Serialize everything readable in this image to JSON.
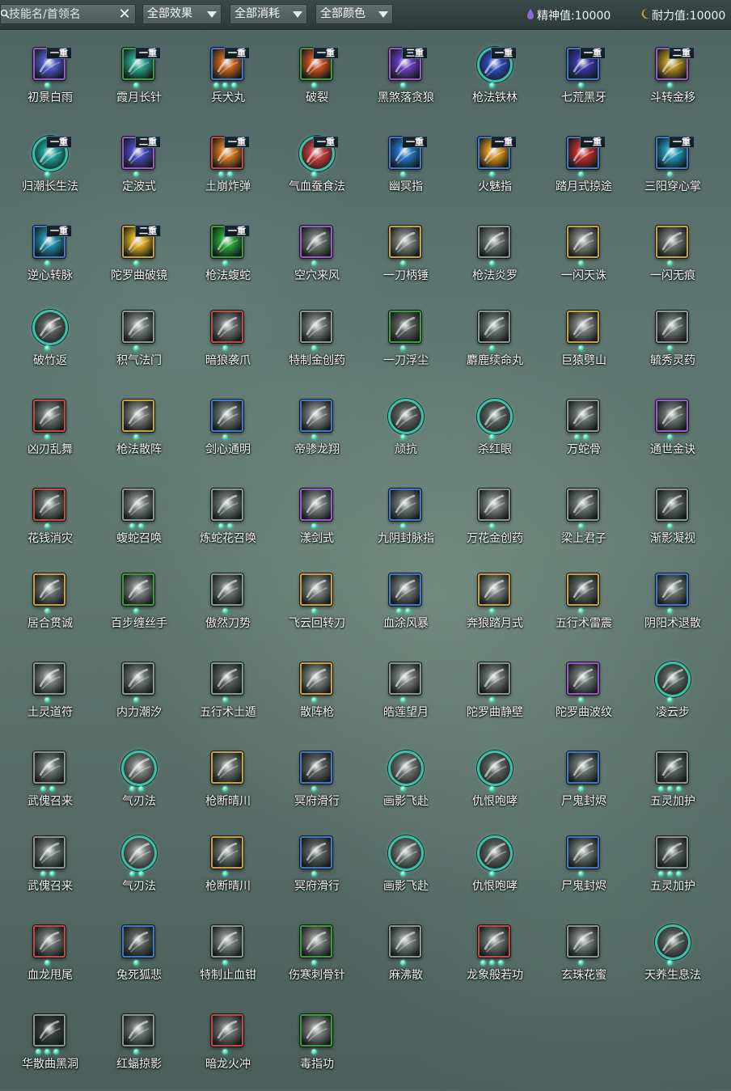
{
  "toolbar": {
    "search_placeholder": "技能名/首领名",
    "clear_label": "✕",
    "filters": [
      {
        "label": "全部效果"
      },
      {
        "label": "全部消耗"
      },
      {
        "label": "全部颜色"
      }
    ],
    "stats": [
      {
        "label": "精神值:10000",
        "icon": "spirit-drop-icon",
        "color": "#8a6cd8"
      },
      {
        "label": "耐力值:10000",
        "icon": "stamina-moon-icon",
        "color": "#d89a3c"
      }
    ]
  },
  "rarity_colors": {
    "gray": "#8a9491",
    "blue": "#3f78c8",
    "purple": "#9a58c8",
    "gold": "#c9a03a",
    "green": "#3f9a3f",
    "red": "#c04848",
    "teal": "#3fbfa8"
  },
  "skills": [
    {
      "name": "初景白雨",
      "tier": "一重",
      "rarity": "purple",
      "shape": "sq",
      "dots": 1,
      "art": "#4d59c9"
    },
    {
      "name": "霞月长针",
      "tier": "一重",
      "rarity": "green",
      "shape": "sq",
      "dots": 1,
      "art": "#2aa58c"
    },
    {
      "name": "兵犬丸",
      "tier": "一重",
      "rarity": "blue",
      "shape": "sq",
      "dots": 3,
      "art": "#c8641e"
    },
    {
      "name": "破裂",
      "tier": "一重",
      "rarity": "green",
      "shape": "sq",
      "dots": 1,
      "art": "#c8501e"
    },
    {
      "name": "黑煞落贪狼",
      "tier": "三重",
      "rarity": "purple",
      "shape": "sq",
      "dots": 1,
      "art": "#6a3cc0"
    },
    {
      "name": "枪法铁林",
      "tier": "一重",
      "rarity": "teal",
      "shape": "circ",
      "dots": 1,
      "art": "#2a48b4"
    },
    {
      "name": "七荒黑牙",
      "tier": "一重",
      "rarity": "blue",
      "shape": "sq",
      "dots": 1,
      "art": "#3838a8"
    },
    {
      "name": "斗转金移",
      "tier": "二重",
      "rarity": "purple",
      "shape": "sq",
      "dots": 1,
      "art": "#b48c1e"
    },
    {
      "name": "归潮长生法",
      "tier": "一重",
      "rarity": "teal",
      "shape": "circ",
      "dots": 1,
      "art": "#1e9c96"
    },
    {
      "name": "定波式",
      "tier": "二重",
      "rarity": "purple",
      "shape": "sq",
      "dots": 1,
      "art": "#4848c0"
    },
    {
      "name": "土崩炸弹",
      "tier": "一重",
      "rarity": "red",
      "shape": "sq",
      "dots": 2,
      "art": "#d8781e"
    },
    {
      "name": "气血蚕食法",
      "tier": "一重",
      "rarity": "teal",
      "shape": "circ",
      "dots": 1,
      "art": "#c03c3c"
    },
    {
      "name": "幽冥指",
      "tier": "一重",
      "rarity": "blue",
      "shape": "sq",
      "dots": 1,
      "art": "#2474c8"
    },
    {
      "name": "火魅指",
      "tier": "一重",
      "rarity": "blue",
      "shape": "sq",
      "dots": 1,
      "art": "#d8901e"
    },
    {
      "name": "踏月式掠途",
      "tier": "一重",
      "rarity": "blue",
      "shape": "sq",
      "dots": 1,
      "art": "#c02c2c"
    },
    {
      "name": "三阳穿心掌",
      "tier": "一重",
      "rarity": "blue",
      "shape": "sq",
      "dots": 1,
      "art": "#1e96b4"
    },
    {
      "name": "逆心转脉",
      "tier": "一重",
      "rarity": "blue",
      "shape": "sq",
      "dots": 1,
      "art": "#1e8ca8"
    },
    {
      "name": "陀罗曲破镜",
      "tier": "二重",
      "rarity": "gold",
      "shape": "sq",
      "dots": 1,
      "art": "#d8a81e"
    },
    {
      "name": "枪法蝮蛇",
      "tier": "一重",
      "rarity": "green",
      "shape": "sq",
      "dots": 1,
      "art": "#2aa03c"
    },
    {
      "name": "空穴来风",
      "tier": "",
      "rarity": "purple",
      "shape": "sq",
      "dots": 1,
      "art": "#6c7470"
    },
    {
      "name": "一刀柄锤",
      "tier": "",
      "rarity": "gold",
      "shape": "sq",
      "dots": 1,
      "art": "#7a807c"
    },
    {
      "name": "枪法炎罗",
      "tier": "",
      "rarity": "gray",
      "shape": "sq",
      "dots": 1,
      "art": "#6c7470"
    },
    {
      "name": "一闪天诛",
      "tier": "",
      "rarity": "gold",
      "shape": "sq",
      "dots": 1,
      "art": "#7a807c"
    },
    {
      "name": "一闪无痕",
      "tier": "",
      "rarity": "gold",
      "shape": "sq",
      "dots": 1,
      "art": "#6c7470"
    },
    {
      "name": "破竹返",
      "tier": "",
      "rarity": "teal",
      "shape": "circ",
      "dots": 1,
      "art": "#5a625e"
    },
    {
      "name": "积气法门",
      "tier": "",
      "rarity": "gray",
      "shape": "sq",
      "dots": 1,
      "art": "#7a807c"
    },
    {
      "name": "暗狼袭爪",
      "tier": "",
      "rarity": "red",
      "shape": "sq",
      "dots": 1,
      "art": "#6c7470"
    },
    {
      "name": "特制金创药",
      "tier": "",
      "rarity": "gray",
      "shape": "sq",
      "dots": 1,
      "art": "#7a807c"
    },
    {
      "name": "一刀浮尘",
      "tier": "",
      "rarity": "green",
      "shape": "sq",
      "dots": 1,
      "art": "#5a625e"
    },
    {
      "name": "麝鹿续命丸",
      "tier": "",
      "rarity": "gray",
      "shape": "sq",
      "dots": 1,
      "art": "#6c7470"
    },
    {
      "name": "巨猿劈山",
      "tier": "",
      "rarity": "gold",
      "shape": "sq",
      "dots": 1,
      "art": "#7a807c"
    },
    {
      "name": "毓秀灵药",
      "tier": "",
      "rarity": "gray",
      "shape": "sq",
      "dots": 1,
      "art": "#6c7470"
    },
    {
      "name": "凶刃乱舞",
      "tier": "",
      "rarity": "red",
      "shape": "sq",
      "dots": 1,
      "art": "#6c7470"
    },
    {
      "name": "枪法散阵",
      "tier": "",
      "rarity": "gold",
      "shape": "sq",
      "dots": 1,
      "art": "#7a807c"
    },
    {
      "name": "剑心通明",
      "tier": "",
      "rarity": "blue",
      "shape": "sq",
      "dots": 1,
      "art": "#6c7470"
    },
    {
      "name": "帝骖龙翔",
      "tier": "",
      "rarity": "blue",
      "shape": "sq",
      "dots": 1,
      "art": "#7a807c"
    },
    {
      "name": "颃抗",
      "tier": "",
      "rarity": "teal",
      "shape": "circ",
      "dots": 1,
      "art": "#5a625e"
    },
    {
      "name": "杀红眼",
      "tier": "",
      "rarity": "teal",
      "shape": "circ",
      "dots": 1,
      "art": "#5a625e"
    },
    {
      "name": "万蛇骨",
      "tier": "",
      "rarity": "gray",
      "shape": "sq",
      "dots": 2,
      "art": "#6c7470"
    },
    {
      "name": "通世金诀",
      "tier": "",
      "rarity": "purple",
      "shape": "sq",
      "dots": 1,
      "art": "#6c7470"
    },
    {
      "name": "花钱消灾",
      "tier": "",
      "rarity": "red",
      "shape": "sq",
      "dots": 1,
      "art": "#6c7470"
    },
    {
      "name": "蝮蛇召唤",
      "tier": "",
      "rarity": "gray",
      "shape": "sq",
      "dots": 2,
      "art": "#7a807c"
    },
    {
      "name": "炼蛇花召唤",
      "tier": "",
      "rarity": "gray",
      "shape": "sq",
      "dots": 2,
      "art": "#6c7470"
    },
    {
      "name": "漾剑式",
      "tier": "",
      "rarity": "purple",
      "shape": "sq",
      "dots": 1,
      "art": "#7a807c"
    },
    {
      "name": "九阴封脉指",
      "tier": "",
      "rarity": "blue",
      "shape": "sq",
      "dots": 1,
      "art": "#6c7470"
    },
    {
      "name": "万花金创药",
      "tier": "",
      "rarity": "gray",
      "shape": "sq",
      "dots": 1,
      "art": "#7a807c"
    },
    {
      "name": "梁上君子",
      "tier": "",
      "rarity": "gray",
      "shape": "sq",
      "dots": 1,
      "art": "#6c7470"
    },
    {
      "name": "渐影凝视",
      "tier": "",
      "rarity": "gray",
      "shape": "sq",
      "dots": 1,
      "art": "#5a625e"
    },
    {
      "name": "居合贯诚",
      "tier": "",
      "rarity": "gold",
      "shape": "sq",
      "dots": 1,
      "art": "#6c7470"
    },
    {
      "name": "百步缠丝手",
      "tier": "",
      "rarity": "green",
      "shape": "sq",
      "dots": 1,
      "art": "#7a807c"
    },
    {
      "name": "傲然刀势",
      "tier": "",
      "rarity": "gray",
      "shape": "sq",
      "dots": 1,
      "art": "#6c7470"
    },
    {
      "name": "飞云回转刀",
      "tier": "",
      "rarity": "gold",
      "shape": "sq",
      "dots": 1,
      "art": "#7a807c"
    },
    {
      "name": "血涂风暴",
      "tier": "",
      "rarity": "blue",
      "shape": "sq",
      "dots": 2,
      "art": "#6c7470"
    },
    {
      "name": "奔狼踏月式",
      "tier": "",
      "rarity": "gold",
      "shape": "sq",
      "dots": 1,
      "art": "#7a807c"
    },
    {
      "name": "五行术雷震",
      "tier": "",
      "rarity": "gold",
      "shape": "sq",
      "dots": 1,
      "art": "#5a625e"
    },
    {
      "name": "阴阳术退散",
      "tier": "",
      "rarity": "blue",
      "shape": "sq",
      "dots": 1,
      "art": "#6c7470"
    },
    {
      "name": "土灵道符",
      "tier": "",
      "rarity": "gray",
      "shape": "sq",
      "dots": 1,
      "art": "#7a807c"
    },
    {
      "name": "内力潮汐",
      "tier": "",
      "rarity": "gray",
      "shape": "sq",
      "dots": 1,
      "art": "#6c7470"
    },
    {
      "name": "五行术土遁",
      "tier": "",
      "rarity": "gray",
      "shape": "sq",
      "dots": 1,
      "art": "#5a625e"
    },
    {
      "name": "散阵枪",
      "tier": "",
      "rarity": "gold",
      "shape": "sq",
      "dots": 1,
      "art": "#7a807c"
    },
    {
      "name": "皓莲望月",
      "tier": "",
      "rarity": "gray",
      "shape": "sq",
      "dots": 1,
      "art": "#7a807c"
    },
    {
      "name": "陀罗曲静壁",
      "tier": "",
      "rarity": "gray",
      "shape": "sq",
      "dots": 1,
      "art": "#6c7470"
    },
    {
      "name": "陀罗曲波纹",
      "tier": "",
      "rarity": "purple",
      "shape": "sq",
      "dots": 1,
      "art": "#6c7470"
    },
    {
      "name": "凌云步",
      "tier": "",
      "rarity": "teal",
      "shape": "circ",
      "dots": 1,
      "art": "#5a625e"
    },
    {
      "name": "武傀召来",
      "tier": "",
      "rarity": "gray",
      "shape": "sq",
      "dots": 2,
      "art": "#6c7470"
    },
    {
      "name": "气刃法",
      "tier": "",
      "rarity": "teal",
      "shape": "circ",
      "dots": 2,
      "art": "#7a807c"
    },
    {
      "name": "枪断晴川",
      "tier": "",
      "rarity": "gold",
      "shape": "sq",
      "dots": 1,
      "art": "#6c7470"
    },
    {
      "name": "冥府滑行",
      "tier": "",
      "rarity": "blue",
      "shape": "sq",
      "dots": 1,
      "art": "#5a625e"
    },
    {
      "name": "画影飞赴",
      "tier": "",
      "rarity": "teal",
      "shape": "circ",
      "dots": 1,
      "art": "#6c7470"
    },
    {
      "name": "仇恨咆哮",
      "tier": "",
      "rarity": "teal",
      "shape": "circ",
      "dots": 1,
      "art": "#5a625e"
    },
    {
      "name": "尸鬼封烬",
      "tier": "",
      "rarity": "blue",
      "shape": "sq",
      "dots": 1,
      "art": "#6c7470"
    },
    {
      "name": "五灵加护",
      "tier": "",
      "rarity": "gray",
      "shape": "sq",
      "dots": 3,
      "art": "#5a625e"
    },
    {
      "name": "武傀召来",
      "tier": "",
      "rarity": "gray",
      "shape": "sq",
      "dots": 2,
      "art": "#6c7470"
    },
    {
      "name": "气刃法",
      "tier": "",
      "rarity": "teal",
      "shape": "circ",
      "dots": 2,
      "art": "#7a807c"
    },
    {
      "name": "枪断晴川",
      "tier": "",
      "rarity": "gold",
      "shape": "sq",
      "dots": 1,
      "art": "#6c7470"
    },
    {
      "name": "冥府滑行",
      "tier": "",
      "rarity": "blue",
      "shape": "sq",
      "dots": 1,
      "art": "#5a625e"
    },
    {
      "name": "画影飞赴",
      "tier": "",
      "rarity": "teal",
      "shape": "circ",
      "dots": 1,
      "art": "#6c7470"
    },
    {
      "name": "仇恨咆哮",
      "tier": "",
      "rarity": "teal",
      "shape": "circ",
      "dots": 1,
      "art": "#5a625e"
    },
    {
      "name": "尸鬼封烬",
      "tier": "",
      "rarity": "blue",
      "shape": "sq",
      "dots": 1,
      "art": "#6c7470"
    },
    {
      "name": "五灵加护",
      "tier": "",
      "rarity": "gray",
      "shape": "sq",
      "dots": 3,
      "art": "#5a625e"
    },
    {
      "name": "血龙甩尾",
      "tier": "",
      "rarity": "red",
      "shape": "sq",
      "dots": 1,
      "art": "#6c7470"
    },
    {
      "name": "兔死狐悲",
      "tier": "",
      "rarity": "blue",
      "shape": "sq",
      "dots": 1,
      "art": "#5a625e"
    },
    {
      "name": "特制止血钳",
      "tier": "",
      "rarity": "gray",
      "shape": "sq",
      "dots": 1,
      "art": "#7a807c"
    },
    {
      "name": "伤寒刺骨针",
      "tier": "",
      "rarity": "green",
      "shape": "sq",
      "dots": 1,
      "art": "#7a807c"
    },
    {
      "name": "麻沸散",
      "tier": "",
      "rarity": "gray",
      "shape": "sq",
      "dots": 1,
      "art": "#7a807c"
    },
    {
      "name": "龙象般若功",
      "tier": "",
      "rarity": "red",
      "shape": "sq",
      "dots": 3,
      "art": "#6c7470"
    },
    {
      "name": "玄珠花蜜",
      "tier": "",
      "rarity": "gray",
      "shape": "sq",
      "dots": 1,
      "art": "#7a807c"
    },
    {
      "name": "天养生息法",
      "tier": "",
      "rarity": "teal",
      "shape": "circ",
      "dots": 1,
      "art": "#5a625e"
    },
    {
      "name": "华散曲黑洞",
      "tier": "",
      "rarity": "gray",
      "shape": "sq",
      "dots": 3,
      "art": "#3a403e"
    },
    {
      "name": "红蝠掠影",
      "tier": "",
      "rarity": "gray",
      "shape": "sq",
      "dots": 1,
      "art": "#6c7470"
    },
    {
      "name": "暗龙火冲",
      "tier": "",
      "rarity": "red",
      "shape": "sq",
      "dots": 1,
      "art": "#6c7470"
    },
    {
      "name": "毒指功",
      "tier": "",
      "rarity": "green",
      "shape": "sq",
      "dots": 1,
      "art": "#7a807c"
    }
  ]
}
